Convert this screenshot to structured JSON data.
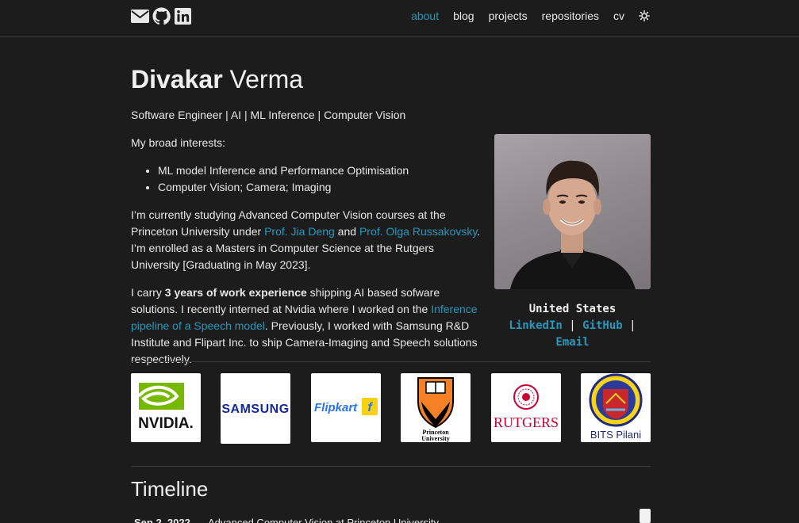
{
  "nav": {
    "icons": [
      "envelope-icon",
      "github-icon",
      "linkedin-icon"
    ],
    "links": [
      {
        "label": "about",
        "active": true
      },
      {
        "label": "blog",
        "active": false
      },
      {
        "label": "projects",
        "active": false
      },
      {
        "label": "repositories",
        "active": false
      },
      {
        "label": "cv",
        "active": false
      }
    ],
    "theme_icon": "sun-icon",
    "accent_color": "#2698ba"
  },
  "profile": {
    "first_name": "Divakar",
    "last_name": "Verma",
    "subtitle": "Software Engineer | AI | ML Inference | Computer Vision",
    "location": "United States",
    "link_linkedin": "LinkedIn",
    "link_github": "GitHub",
    "link_email": "Email",
    "separator": "|"
  },
  "about": {
    "interests_intro": "My broad interests:",
    "interests": [
      "ML model Inference and Performance Optimisation",
      "Computer Vision; Camera; Imaging"
    ],
    "p1_a": "I’m currently studying Advanced Computer Vision courses at the Princeton University under ",
    "p1_link1": "Prof. Jia Deng",
    "p1_b": " and ",
    "p1_link2": "Prof. Olga Russakovsky",
    "p1_c": ". I’m enrolled as a Masters in Computer Science at the Rutgers University [Graduating in May 2023].",
    "p2_a": "I carry ",
    "p2_bold": "3 years of work experience",
    "p2_b": " shipping AI based sofware solutions. I recently interned at Nvidia where I worked on the ",
    "p2_link": "Inference pipeline of a Speech model",
    "p2_c": ". Previously, I worked with Samsung R&D Institute and Flipart Inc. to ship Camera-Imaging and Speech solutions respectively."
  },
  "logos": [
    {
      "name": "nvidia-logo",
      "text": "NVIDIA."
    },
    {
      "name": "samsung-logo",
      "text": "SAMSUNG"
    },
    {
      "name": "flipkart-logo",
      "text": "Flipkart"
    },
    {
      "name": "princeton-logo",
      "text": "Princeton University"
    },
    {
      "name": "rutgers-logo",
      "text": "RUTGERS"
    },
    {
      "name": "bits-logo",
      "text": "BITS Pilani"
    }
  ],
  "timeline": {
    "title": "Timeline",
    "rows": [
      {
        "date": "Sep 2, 2022",
        "text": "Advanced Computer Vision at Princeton University"
      }
    ]
  }
}
